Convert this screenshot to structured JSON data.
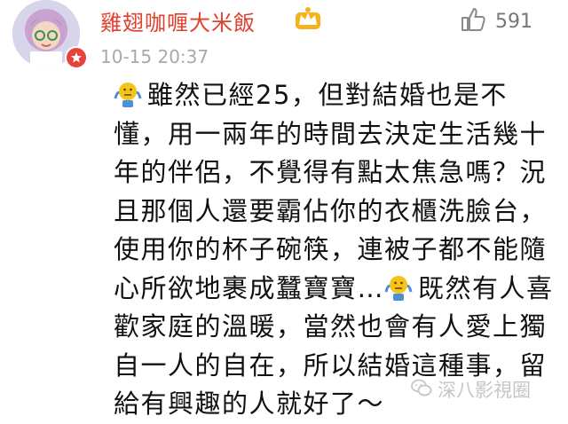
{
  "user": {
    "name": "雞翅咖喱大米飯"
  },
  "comment": {
    "timestamp": "10-15 20:37",
    "likes": "591",
    "segments": [
      "雖然已經25，但對結婚也是不懂，用一兩年的時間去決定生活幾十年的伴侶，不覺得有點太焦急嗎？況且那個人還要霸佔你的衣櫃洗臉台，使用你的杯子碗筷，連被子都不能隨心所欲地裹成蠶寶寶…",
      "既然有人喜歡家庭的溫暖，當然也會有人愛上獨自一人的自在，所以結婚這種事，留給有興趣的人就好了～"
    ]
  },
  "watermark": {
    "text": "深八影視圈"
  },
  "colors": {
    "username": "#e2402f",
    "badge": "#e8423c",
    "timestamp": "#a9a9a9",
    "emoji": "#f5c419"
  },
  "icons": [
    "avatar",
    "verified-badge-icon",
    "member-crown-icon",
    "thumbs-up-icon",
    "shrug-emoji-icon",
    "wechat-icon"
  ]
}
